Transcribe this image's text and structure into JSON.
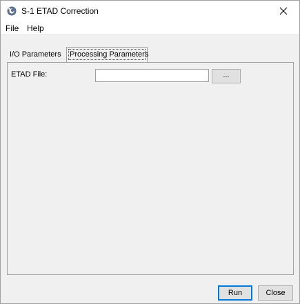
{
  "window": {
    "title": "S-1 ETAD Correction",
    "close_glyph": "✕",
    "app_icon": "snap-logo-icon"
  },
  "menu": {
    "items": [
      {
        "label": "File"
      },
      {
        "label": "Help"
      }
    ]
  },
  "tabs": [
    {
      "label": "I/O Parameters",
      "selected": false
    },
    {
      "label": "Processing Parameters",
      "selected": true
    }
  ],
  "form": {
    "etad_file_label": "ETAD File:",
    "etad_file_value": "",
    "browse_label": "..."
  },
  "buttons": {
    "run_label": "Run",
    "close_label": "Close"
  },
  "colors": {
    "window_bg": "#f0f0f0",
    "titlebar_bg": "#ffffff",
    "default_button_border": "#0078d7"
  }
}
